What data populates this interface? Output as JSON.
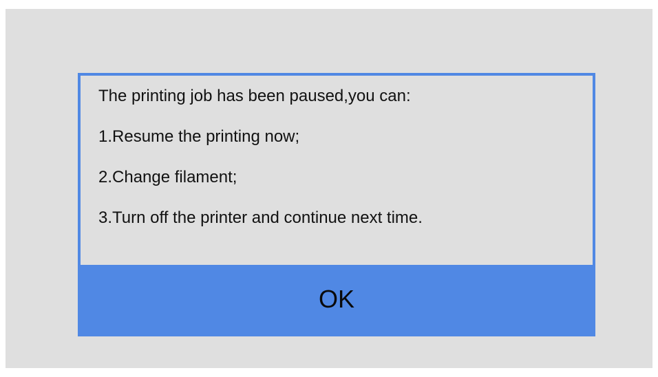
{
  "dialog": {
    "lines": [
      "The printing job has been paused,you can:",
      "1.Resume the printing now;",
      "2.Change filament;",
      "3.Turn off the printer and continue next time."
    ],
    "ok_label": "OK"
  },
  "colors": {
    "background": "#dfdfdf",
    "accent": "#5088e4",
    "text": "#111111"
  }
}
